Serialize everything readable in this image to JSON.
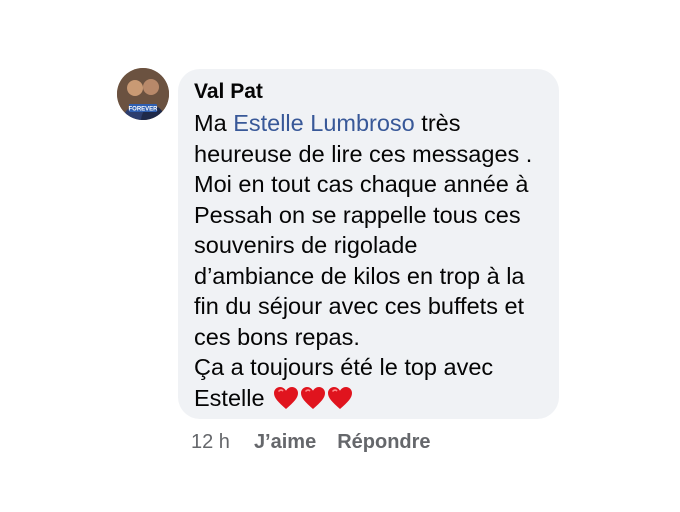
{
  "comment": {
    "author": "Val Pat",
    "avatar_text": "FOREVER",
    "text_lines": [
      {
        "before": "Ma ",
        "mention": "Estelle Lumbroso",
        "after": " très"
      },
      {
        "text": "heureuse de lire ces messages ."
      },
      {
        "text": "Moi en tout cas chaque année à"
      },
      {
        "text": "Pessah on se rappelle tous ces"
      },
      {
        "text": "souvenirs de rigolade"
      },
      {
        "text": "d’ambiance de kilos en trop à la"
      },
      {
        "text": "fin du séjour avec ces buffets et"
      },
      {
        "text": "ces bons repas."
      },
      {
        "text": "Ça a toujours été le top avec"
      },
      {
        "text": "Estelle"
      }
    ],
    "emoji": [
      "red-heart",
      "red-heart",
      "red-heart"
    ]
  },
  "actions": {
    "timestamp": "12 h",
    "like_label": "J’aime",
    "reply_label": "Répondre"
  },
  "colors": {
    "bubble": "#f0f2f5",
    "mention": "#385898",
    "meta": "#65676b",
    "heart": "#e0141e"
  }
}
